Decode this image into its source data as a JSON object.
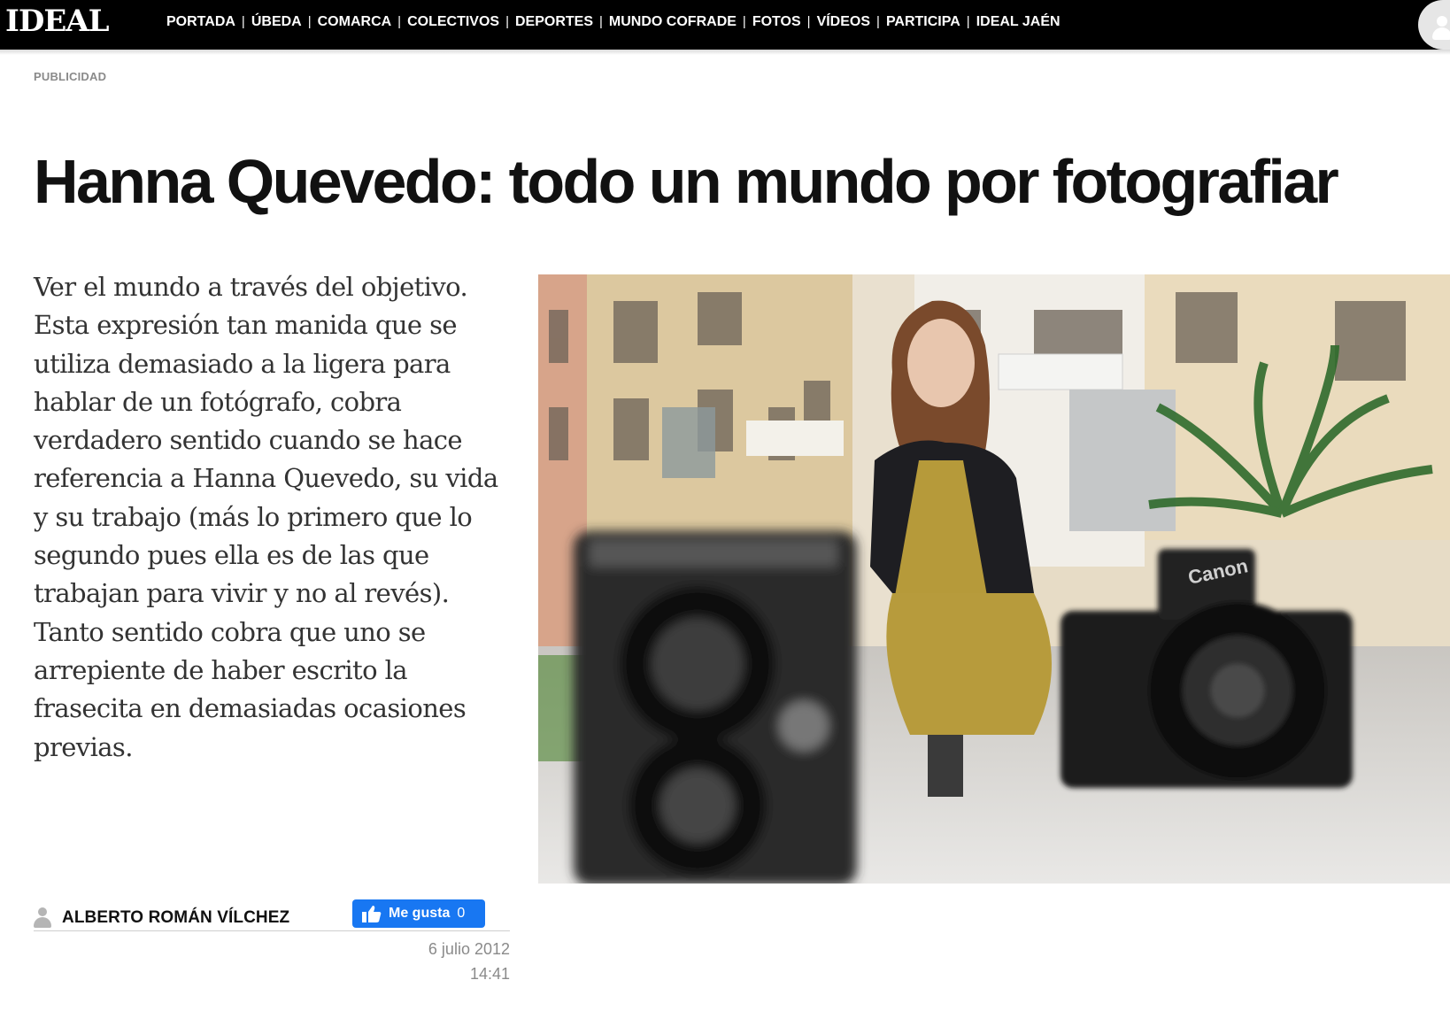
{
  "site": {
    "logo": "IDEAL"
  },
  "nav": {
    "items": [
      {
        "label": "PORTADA"
      },
      {
        "label": "ÚBEDA"
      },
      {
        "label": "COMARCA"
      },
      {
        "label": "COLECTIVOS"
      },
      {
        "label": "DEPORTES"
      },
      {
        "label": "MUNDO COFRADE"
      },
      {
        "label": "FOTOS"
      },
      {
        "label": "VÍDEOS"
      },
      {
        "label": "PARTICIPA"
      },
      {
        "label": "IDEAL JAÉN"
      }
    ],
    "separator": "|"
  },
  "ad": {
    "label": "PUBLICIDAD"
  },
  "article": {
    "title": "Hanna Quevedo: todo un mundo por fotografiar",
    "lead_lines": [
      "Ver el mundo a través del objetivo.",
      "Esta expresión tan manida que se",
      "utiliza demasiado a la ligera para",
      "hablar de un fotógrafo, cobra",
      "verdadero sentido cuando se hace",
      "referencia a Hanna Quevedo, su vida",
      "y su trabajo (más lo primero que lo",
      "segundo pues ella es de las que",
      "trabajan para vivir y no al revés).",
      "Tanto sentido cobra que uno se",
      "arrepiente de haber escrito la",
      "frasecita en demasiadas ocasiones",
      "previas."
    ],
    "author": "ALBERTO ROMÁN VÍLCHEZ",
    "date": "6 julio 2012",
    "time": "14:41",
    "photo_camera_brand": "Canon"
  },
  "like_button": {
    "label": "Me gusta",
    "count": "0"
  },
  "colors": {
    "topbar": "#000000",
    "like_blue": "#1877f2",
    "headline": "#111111",
    "lead_text": "#333333",
    "meta_gray": "#8a8a8a"
  },
  "icons": {
    "user": "user-silhouette-icon",
    "author": "author-silhouette-icon",
    "like": "thumbs-up-icon"
  }
}
